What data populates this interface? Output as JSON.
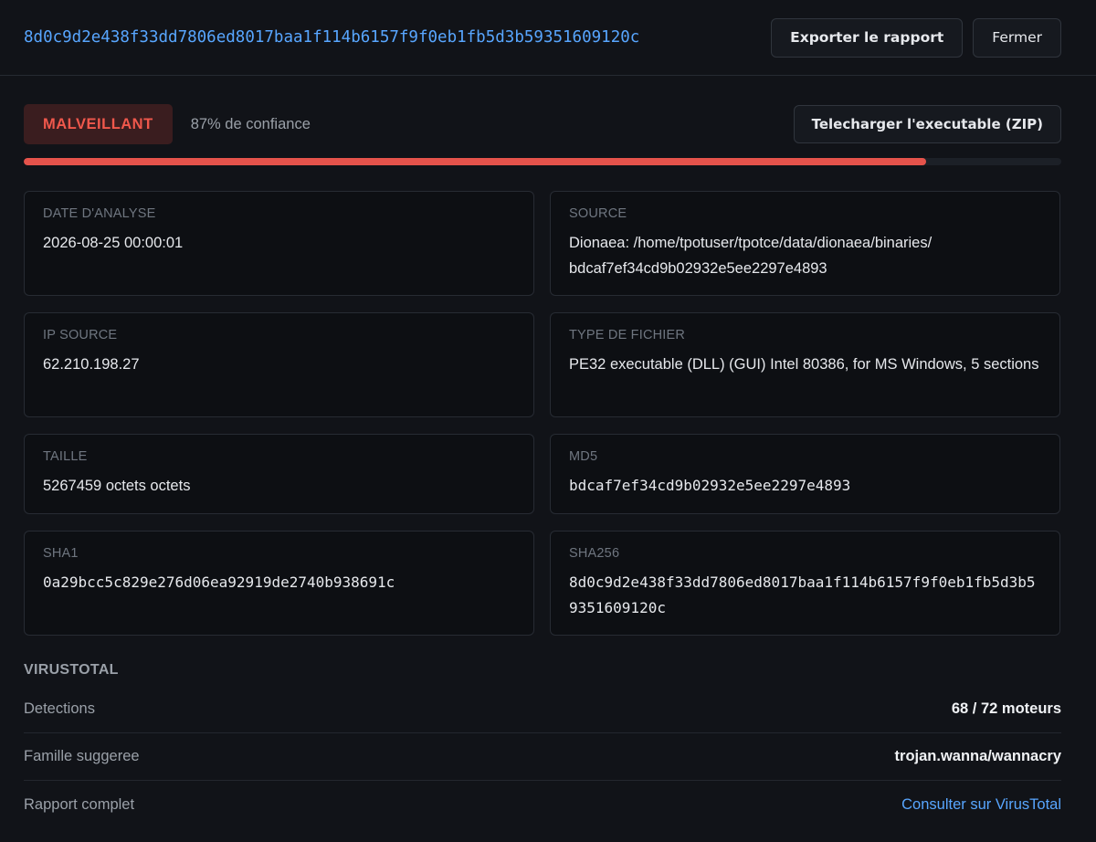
{
  "header": {
    "hash": "8d0c9d2e438f33dd7806ed8017baa1f114b6157f9f0eb1fb5d3b59351609120c",
    "export_label": "Exporter le rapport",
    "close_label": "Fermer"
  },
  "verdict": {
    "label": "MALVEILLANT",
    "confidence_text": "87% de confiance",
    "confidence_value": 0.87,
    "download_label": "Telecharger l'executable (ZIP)",
    "color": "#e5534b"
  },
  "details": {
    "date": {
      "label": "DATE D'ANALYSE",
      "value": "2026-08-25 00:00:01"
    },
    "source": {
      "label": "SOURCE",
      "value": "Dionaea: /home/tpotuser/tpotce/data/dionaea/binaries/ bdcaf7ef34cd9b02932e5ee2297e4893"
    },
    "ip": {
      "label": "IP SOURCE",
      "value": "62.210.198.27"
    },
    "filetype": {
      "label": "TYPE DE FICHIER",
      "value": "PE32 executable (DLL) (GUI) Intel 80386, for MS Windows, 5 sections"
    },
    "size": {
      "label": "TAILLE",
      "value": "5267459 octets octets"
    },
    "md5": {
      "label": "MD5",
      "value": "bdcaf7ef34cd9b02932e5ee2297e4893"
    },
    "sha1": {
      "label": "SHA1",
      "value": "0a29bcc5c829e276d06ea92919de2740b938691c"
    },
    "sha256": {
      "label": "SHA256",
      "value": "8d0c9d2e438f33dd7806ed8017baa1f114b6157f9f0eb1fb5d3b59351609120c"
    }
  },
  "virustotal": {
    "title": "VIRUSTOTAL",
    "detections_label": "Detections",
    "detections_value": "68 / 72 moteurs",
    "family_label": "Famille suggeree",
    "family_value": "trojan.wanna/wannacry",
    "report_label": "Rapport complet",
    "report_link": "Consulter sur VirusTotal"
  }
}
